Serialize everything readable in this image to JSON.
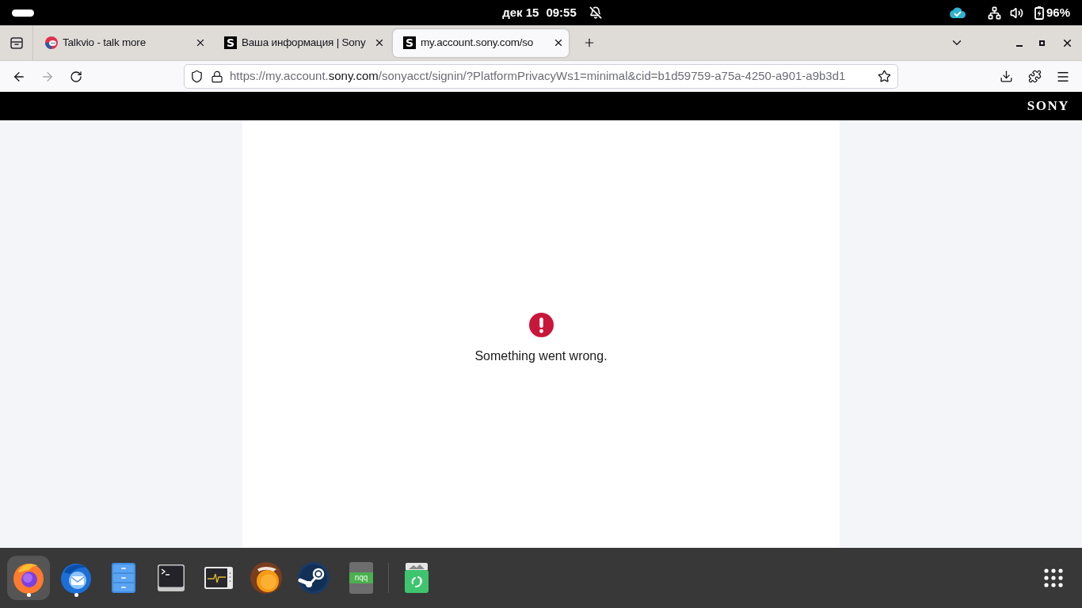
{
  "top_bar": {
    "date": "дек 15",
    "time": "09:55",
    "battery": "96%"
  },
  "browser": {
    "tabs": [
      {
        "title": "Talkvio - talk more",
        "favicon": {
          "kind": "chat"
        },
        "selected": false
      },
      {
        "title": "Ваша информация | Sony",
        "favicon": {
          "kind": "letter",
          "text": "S"
        },
        "selected": false
      },
      {
        "title": "my.account.sony.com/so",
        "favicon": {
          "kind": "letter",
          "text": "S"
        },
        "selected": true
      }
    ],
    "navigation": {
      "back": {
        "disabled": false
      },
      "forward": {
        "disabled": true
      }
    },
    "address": {
      "prefix": "https://my.account.",
      "domain": "sony.com",
      "path": "/sonyacct/signin/?PlatformPrivacyWs1=minimal&cid=b1d59759-a75a-4250-a901-a9b3d1"
    }
  },
  "page": {
    "header": {
      "logo": "SONY"
    },
    "error": {
      "message": "Something went wrong."
    }
  },
  "dock": {
    "apps": [
      {
        "kind": "browser",
        "running": true,
        "selected": true
      },
      {
        "kind": "mail",
        "running": true,
        "selected": false
      },
      {
        "kind": "files",
        "running": false,
        "selected": false
      },
      {
        "kind": "terminal",
        "running": false,
        "selected": false
      },
      {
        "kind": "monitor",
        "running": false,
        "selected": false
      },
      {
        "kind": "disc",
        "running": false,
        "selected": false
      },
      {
        "kind": "game",
        "running": false,
        "selected": false
      },
      {
        "kind": "notebook",
        "label": "nqq",
        "running": false,
        "selected": false
      }
    ]
  }
}
